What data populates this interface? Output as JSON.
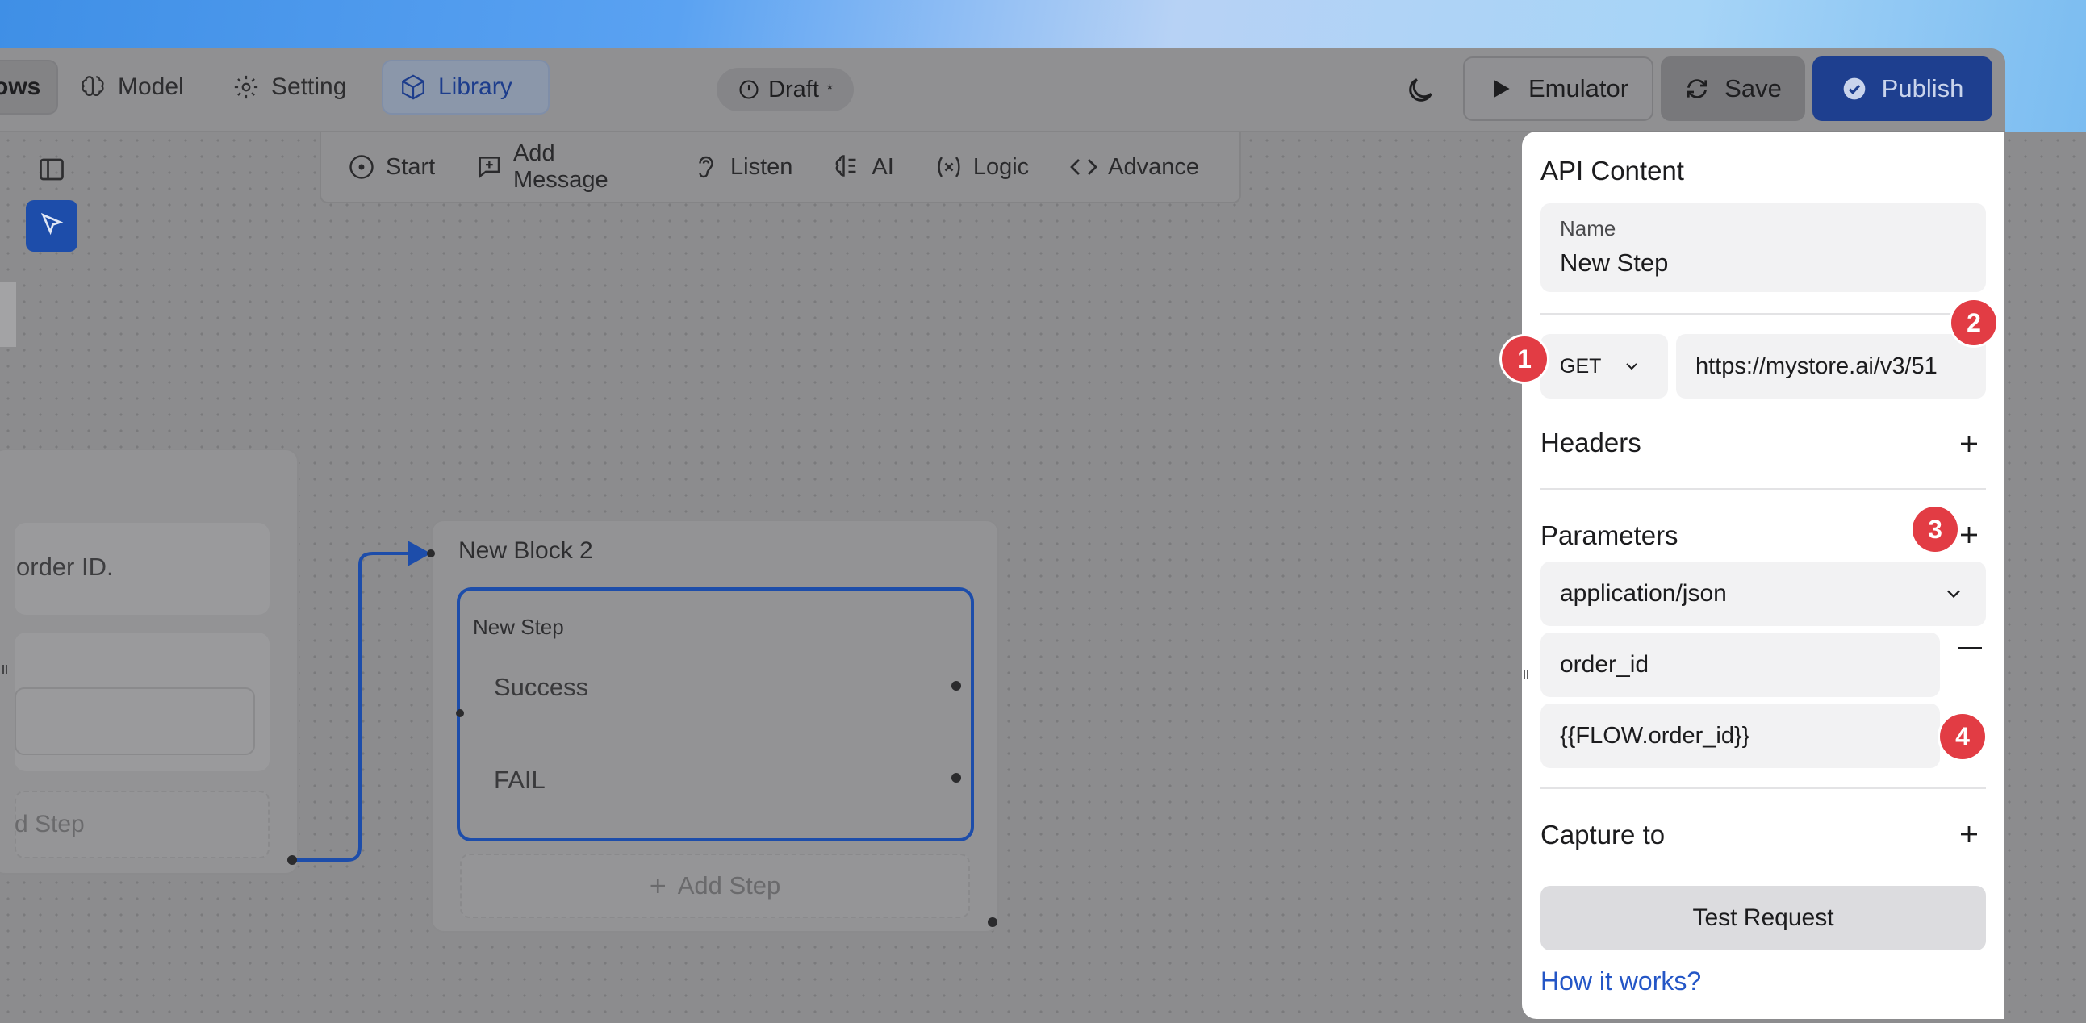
{
  "nav": {
    "flows": "ows",
    "model": "Model",
    "setting": "Setting",
    "library": "Library"
  },
  "draft": {
    "label": "Draft",
    "marker": "*"
  },
  "actions": {
    "emulator": "Emulator",
    "save": "Save",
    "publish": "Publish"
  },
  "toolbar": {
    "items": [
      "Start",
      "Add Message",
      "Listen",
      "AI",
      "Logic",
      "Advance"
    ]
  },
  "block1": {
    "row1_text": "order ID.",
    "add_step": "d Step"
  },
  "block2": {
    "title": "New Block 2",
    "step_label": "New Step",
    "success": "Success",
    "fail": "FAIL",
    "add_step": "Add Step"
  },
  "panel": {
    "title": "API Content",
    "name_label": "Name",
    "name_value": "New Step",
    "method": "GET",
    "url": "https://mystore.ai/v3/51",
    "headers": "Headers",
    "parameters": "Parameters",
    "content_type": "application/json",
    "param_key": "order_id",
    "param_value": "{{FLOW.order_id}}",
    "capture": "Capture to",
    "test_button": "Test Request",
    "how_link": "How it works?"
  },
  "badges": [
    "1",
    "2",
    "3",
    "4"
  ],
  "colors": {
    "accent": "#1d4daa",
    "publish": "#1e3f8f",
    "badge": "#e23c44",
    "link": "#2456c6"
  }
}
